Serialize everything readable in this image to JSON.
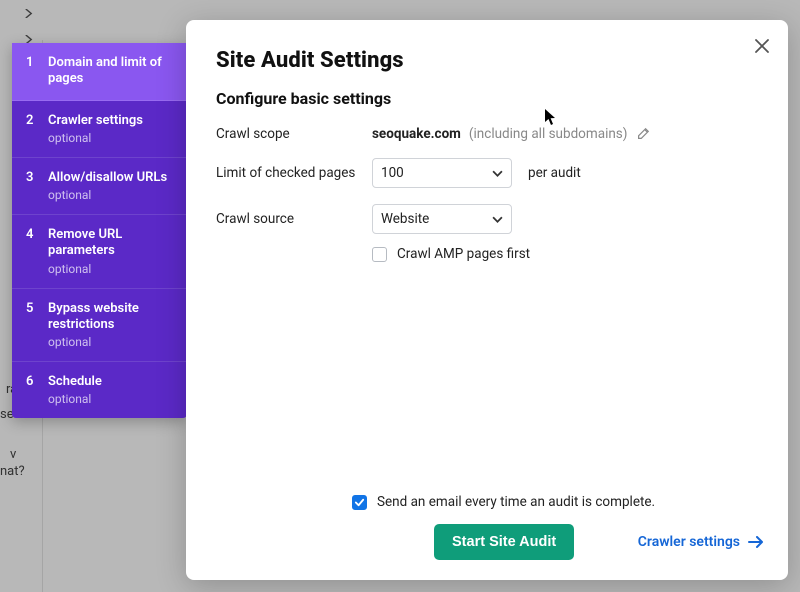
{
  "bg_snippets": {
    "a": "ram",
    "b": "se or",
    "c": "v",
    "d": "nat?"
  },
  "sidebar": {
    "optional_label": "optional",
    "items": [
      {
        "title": "Domain and limit of pages",
        "optional": false
      },
      {
        "title": "Crawler settings",
        "optional": true
      },
      {
        "title": "Allow/disallow URLs",
        "optional": true
      },
      {
        "title": "Remove URL parameters",
        "optional": true
      },
      {
        "title": "Bypass website restrictions",
        "optional": true
      },
      {
        "title": "Schedule",
        "optional": true
      }
    ],
    "active_index": 0
  },
  "modal": {
    "title": "Site Audit Settings",
    "subtitle": "Configure basic settings",
    "labels": {
      "crawl_scope": "Crawl scope",
      "limit_pages": "Limit of checked pages",
      "crawl_source": "Crawl source",
      "per_audit": "per audit",
      "scope_note": "(including all subdomains)",
      "amp_first": "Crawl AMP pages first",
      "email_note": "Send an email every time an audit is complete.",
      "start_button": "Start Site Audit",
      "next_link": "Crawler settings"
    },
    "values": {
      "domain": "seoquake.com",
      "limit_pages": "100",
      "crawl_source": "Website",
      "amp_first_checked": false,
      "email_checked": true
    }
  }
}
